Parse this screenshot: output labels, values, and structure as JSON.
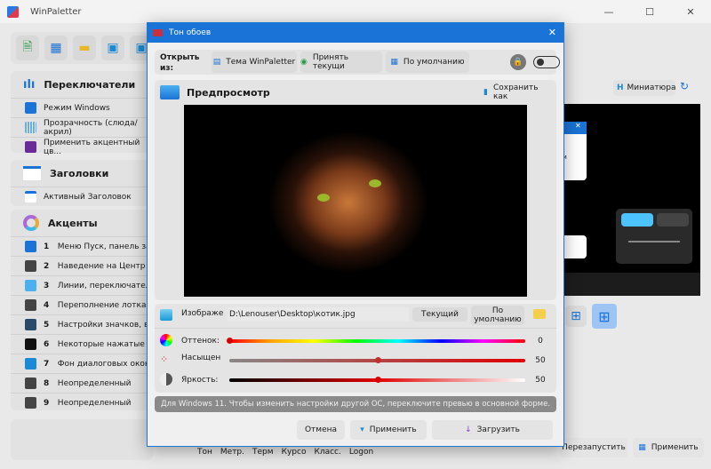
{
  "main": {
    "title": "WinPaletter",
    "toolbar": [
      "new-from-file-icon",
      "new-icon",
      "open-folder-icon",
      "save-icon",
      "save-as-icon"
    ],
    "sections": {
      "toggles": {
        "title": "Переключатели",
        "items": [
          "Режим Windows",
          "Прозрачность (слюда/акрил)",
          "Применить акцентный цв..."
        ]
      },
      "titlebars": {
        "title": "Заголовки",
        "items": [
          "Активный Заголовок"
        ]
      },
      "accents": {
        "title": "Акценты",
        "items": [
          {
            "n": "1",
            "label": "Меню Пуск, панель задач и"
          },
          {
            "n": "2",
            "label": "Наведение на Центр действи"
          },
          {
            "n": "3",
            "label": "Линии, переключатели и кн"
          },
          {
            "n": "4",
            "label": "Переполнение лотка панели"
          },
          {
            "n": "5",
            "label": "Настройки значков, выделе"
          },
          {
            "n": "6",
            "label": "Некоторые нажатые кнопки"
          },
          {
            "n": "7",
            "label": "Фон диалоговых окон UWP"
          },
          {
            "n": "8",
            "label": "Неопределенный"
          },
          {
            "n": "9",
            "label": "Неопределенный"
          }
        ]
      }
    },
    "preview_label": "Миниатюра",
    "preview_partial_text": "ки",
    "bottom_tabs": [
      "Тон",
      "Метр.",
      "Терм",
      "Курсо",
      "Класс.",
      "Logon"
    ],
    "restart_label": "Перезапустить",
    "apply_label": "Применить"
  },
  "dialog": {
    "title": "Тон обоев",
    "open_from_label": "Открыть из:",
    "open_buttons": [
      "Тема WinPaletter",
      "Принять текущи",
      "По умолчанию"
    ],
    "toggle_on": false,
    "preview_title": "Предпросмотр",
    "save_as_label": "Сохранить как",
    "image_label": "Изображе",
    "image_path": "D:\\Lenouser\\Desktop\\котик.jpg",
    "current_label": "Текущий",
    "default_label": "По умолчанию",
    "hue": {
      "label": "Оттенок:",
      "value": "0"
    },
    "saturation": {
      "label": "Насыщен",
      "value": "50"
    },
    "brightness": {
      "label": "Яркость:",
      "value": "50"
    },
    "note": "Для Windows 11. Чтобы изменить настройки другой ОС, переключите превью в основной форме.",
    "cancel_label": "Отмена",
    "apply_label": "Применить",
    "load_label": "Загрузить"
  },
  "colors": {
    "accent": "#1a73d6",
    "knob": "#d80000"
  }
}
